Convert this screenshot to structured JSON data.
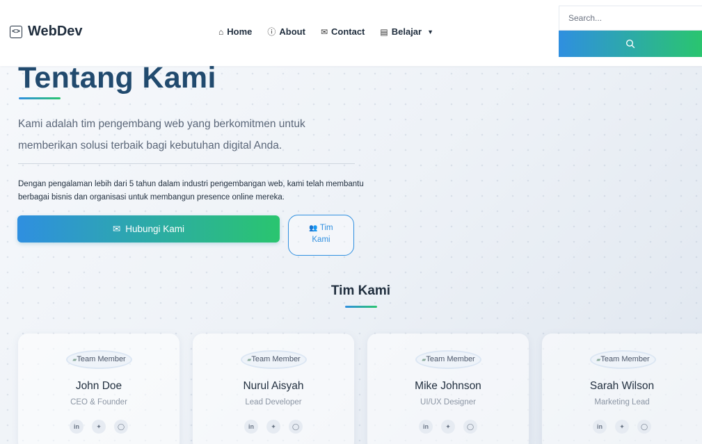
{
  "header": {
    "brand": "WebDev",
    "nav": [
      {
        "label": "Home",
        "icon": "home-icon"
      },
      {
        "label": "About",
        "icon": "info-icon"
      },
      {
        "label": "Contact",
        "icon": "mail-icon"
      },
      {
        "label": "Belajar",
        "icon": "book-icon",
        "dropdown": true
      }
    ],
    "search": {
      "placeholder": "Search..."
    }
  },
  "hero": {
    "title": "Tentang Kami",
    "lead": "Kami adalah tim pengembang web yang berkomitmen untuk memberikan solusi terbaik bagi kebutuhan digital Anda.",
    "description": "Dengan pengalaman lebih dari 5 tahun dalam industri pengembangan web, kami telah membantu berbagai bisnis dan organisasi untuk membangun presence online mereka.",
    "primary_button": "Hubungi Kami",
    "secondary_button": "Tim Kami"
  },
  "team": {
    "title": "Tim Kami",
    "members": [
      {
        "alt": "Team Member",
        "name": "John Doe",
        "role": "CEO & Founder"
      },
      {
        "alt": "Team Member",
        "name": "Nurul Aisyah",
        "role": "Lead Developer"
      },
      {
        "alt": "Team Member",
        "name": "Mike Johnson",
        "role": "UI/UX Designer"
      },
      {
        "alt": "Team Member",
        "name": "Sarah Wilson",
        "role": "Marketing Lead"
      }
    ]
  },
  "colors": {
    "accent_blue": "#2f8fe0",
    "accent_green": "#2ac56f",
    "title": "#214a6e"
  }
}
